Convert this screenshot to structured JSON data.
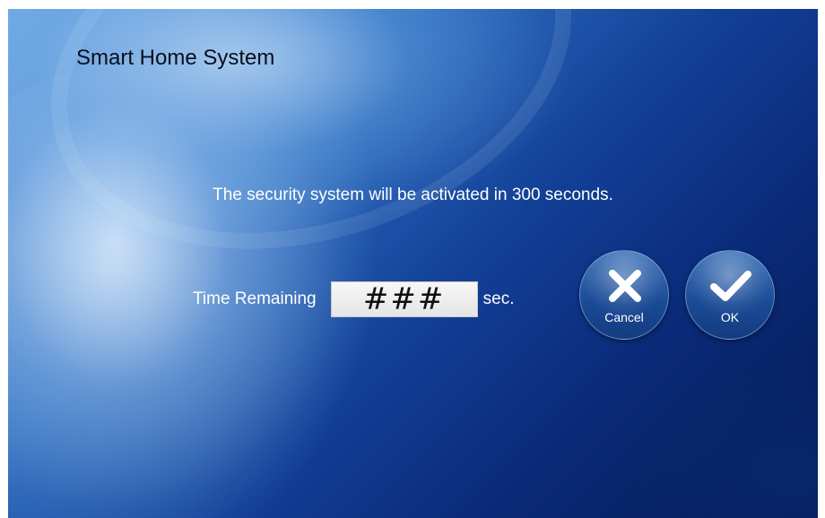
{
  "app": {
    "title": "Smart Home System"
  },
  "message": "The security system will be activated in 300 seconds.",
  "timer": {
    "label": "Time Remaining",
    "value": "###",
    "unit": "sec."
  },
  "buttons": {
    "cancel_label": "Cancel",
    "ok_label": "OK"
  },
  "icons": {
    "cancel": "close-icon",
    "ok": "checkmark-icon"
  },
  "colors": {
    "text_light": "#ffffff",
    "title_text": "#0a0f1e",
    "button_blue": "#1a4a95",
    "background_dark": "#0a2a78"
  }
}
